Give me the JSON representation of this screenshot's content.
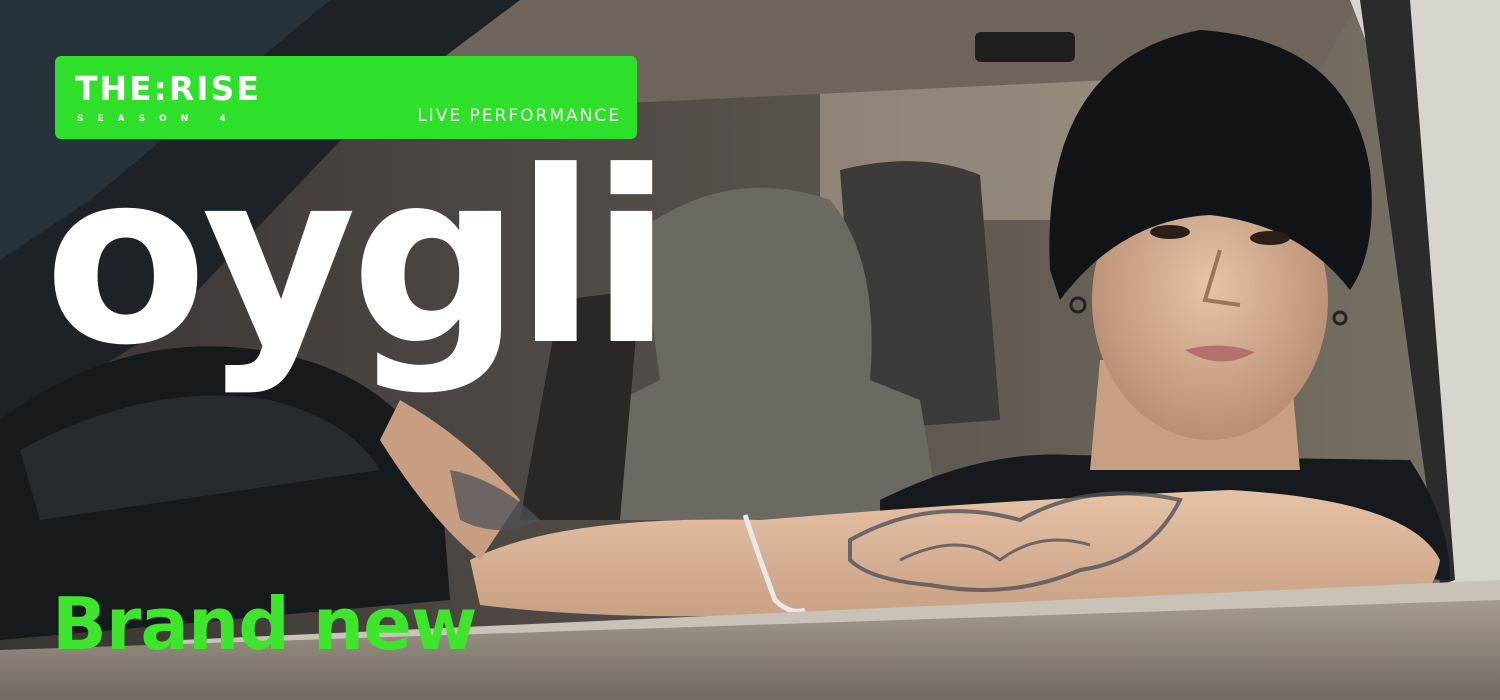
{
  "badge": {
    "brand": "THE:RISE",
    "season": "SEASON 4",
    "tag": "LIVE PERFORMANCE",
    "color": "#2ee02a"
  },
  "artist_name": "oygli",
  "tagline": "Brand new",
  "colors": {
    "tagline": "#3fe42c",
    "title": "#ffffff"
  }
}
